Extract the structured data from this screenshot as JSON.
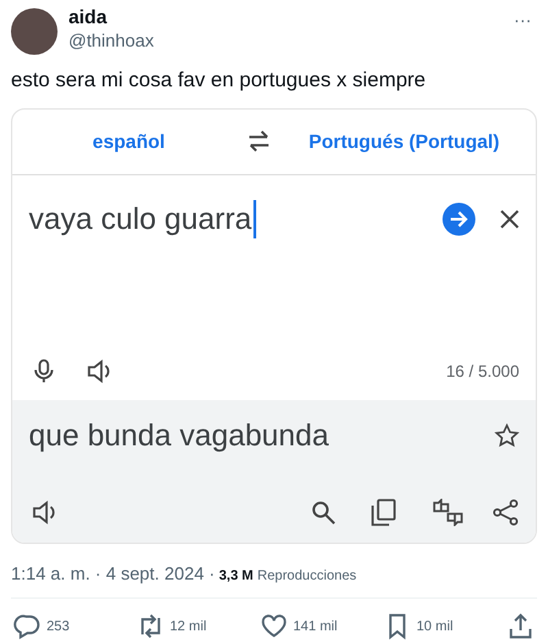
{
  "author": {
    "name": "aida",
    "handle": "@thinhoax"
  },
  "more": "···",
  "text": "esto sera mi cosa fav en portugues x siempre",
  "translator": {
    "source_lang": "español",
    "target_lang": "Portugués (Portugal)",
    "input": "vaya culo guarra",
    "char_count": "16 / 5.000",
    "output": "que bunda vagabunda"
  },
  "meta": {
    "time": "1:14 a. m. · 4 sept. 2024 ·",
    "views": "3,3 M",
    "views_label": "Reproducciones"
  },
  "actions": [
    {
      "kind": "reply",
      "count": "253"
    },
    {
      "kind": "repost",
      "count": "12 mil"
    },
    {
      "kind": "like",
      "count": "141 mil"
    },
    {
      "kind": "bookmark",
      "count": "10 mil"
    },
    {
      "kind": "share"
    }
  ]
}
